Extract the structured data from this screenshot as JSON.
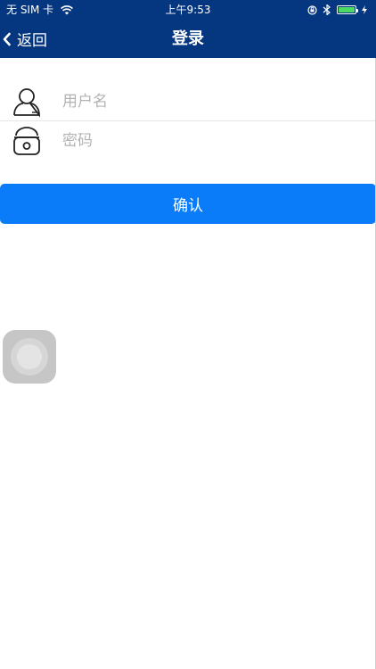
{
  "status_bar": {
    "carrier": "无 SIM 卡",
    "time": "上午9:53",
    "battery_color": "#4cd964"
  },
  "nav": {
    "back_label": "返回",
    "title": "登录"
  },
  "form": {
    "username_placeholder": "用户名",
    "password_placeholder": "密码",
    "username_icon": "user-icon",
    "password_icon": "lock-icon"
  },
  "confirm_label": "确认",
  "colors": {
    "header_bg": "#053680",
    "button_bg": "#0a7cf9",
    "placeholder": "#b3b3b3"
  }
}
